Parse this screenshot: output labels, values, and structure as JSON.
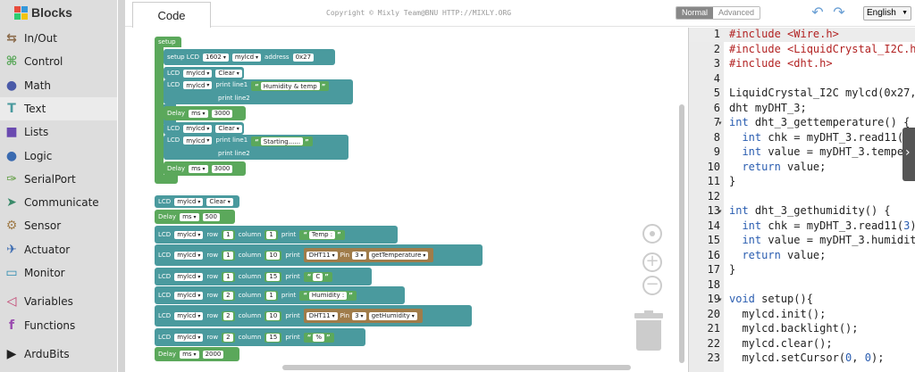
{
  "toolbox": {
    "title": "Blocks",
    "categories": [
      {
        "label": "In/Out",
        "icon": "arrows-icon",
        "color": "#8a6a4a",
        "glyph": "⇆"
      },
      {
        "label": "Control",
        "icon": "gamepad-icon",
        "color": "#5ba85b",
        "glyph": "⌘"
      },
      {
        "label": "Math",
        "icon": "math-icon",
        "color": "#4a5aa8",
        "glyph": "●"
      },
      {
        "label": "Text",
        "icon": "text-icon",
        "color": "#4a9a9e",
        "glyph": "T"
      },
      {
        "label": "Lists",
        "icon": "lists-icon",
        "color": "#6a4ab0",
        "glyph": "■"
      },
      {
        "label": "Logic",
        "icon": "bulb-icon",
        "color": "#3a6ab0",
        "glyph": "●"
      },
      {
        "label": "SerialPort",
        "icon": "plug-icon",
        "color": "#5a9a3a",
        "glyph": "✑"
      },
      {
        "label": "Communicate",
        "icon": "antenna-icon",
        "color": "#3a8a6a",
        "glyph": "➤"
      },
      {
        "label": "Sensor",
        "icon": "sensor-icon",
        "color": "#a07c4a",
        "glyph": "⚙"
      },
      {
        "label": "Actuator",
        "icon": "actuator-icon",
        "color": "#3a6ab0",
        "glyph": "✈"
      },
      {
        "label": "Monitor",
        "icon": "monitor-icon",
        "color": "#2a8ab0",
        "glyph": "▭"
      },
      {
        "label": "Variables",
        "icon": "variables-icon",
        "color": "#c03a6a",
        "glyph": "◁"
      },
      {
        "label": "Functions",
        "icon": "functions-icon",
        "color": "#9a4ab0",
        "glyph": "f"
      },
      {
        "label": "ArduBits",
        "icon": "play-icon",
        "color": "#222222",
        "glyph": "▶"
      }
    ],
    "selected": "Text"
  },
  "topbar": {
    "code_tab": "Code",
    "copyright": "Copyright © Mixly Team@BNU HTTP://MIXLY.ORG",
    "mode_normal": "Normal",
    "mode_advanced": "Advanced",
    "language": "English"
  },
  "workspace": {
    "setup": "setup",
    "setup_lcd": "setup LCD",
    "lcd_type": "1602",
    "lcd_name": "mylcd",
    "address_label": "address",
    "address": "0x27",
    "lcd": "LCD",
    "clear": "Clear",
    "print_line1": "print line1",
    "print_line2": "print line2",
    "delay": "Delay",
    "ms": "ms",
    "delay_3000": "3000",
    "delay_500": "500",
    "delay_2000": "2000",
    "text_humidity_temp": "Humidity & temp",
    "text_starting": "Starting......",
    "row": "row",
    "column": "column",
    "print": "print",
    "one": "1",
    "two": "2",
    "ten": "10",
    "fifteen": "15",
    "text_temp": "Temp :",
    "text_c": "C",
    "text_humidity": "Humidity :",
    "text_pct": "%",
    "dht": "DHT11",
    "pin": "Pin",
    "pin_value": "3",
    "get_temperature": "getTemperature",
    "get_humidity": "getHumidity"
  },
  "code": {
    "lines": [
      {
        "n": "1",
        "segs": [
          [
            "pp",
            "#include <Wire.h>"
          ]
        ]
      },
      {
        "n": "2",
        "segs": [
          [
            "pp",
            "#include <LiquidCrystal_I2C.h>"
          ]
        ]
      },
      {
        "n": "3",
        "segs": [
          [
            "pp",
            "#include <dht.h>"
          ]
        ]
      },
      {
        "n": "4",
        "segs": []
      },
      {
        "n": "5",
        "segs": [
          [
            "",
            "LiquidCrystal_I2C mylcd(0x27,16,2);"
          ]
        ]
      },
      {
        "n": "6",
        "segs": [
          [
            "",
            "dht myDHT_3;"
          ]
        ]
      },
      {
        "n": "7",
        "fold": true,
        "segs": [
          [
            "kw",
            "int"
          ],
          [
            "",
            " dht_3_gettemperature() {"
          ]
        ]
      },
      {
        "n": "8",
        "segs": [
          [
            "",
            "  "
          ],
          [
            "kw",
            "int"
          ],
          [
            "",
            " chk = myDHT_3.read11("
          ],
          [
            "num",
            "3"
          ],
          [
            "",
            ");"
          ]
        ]
      },
      {
        "n": "9",
        "segs": [
          [
            "",
            "  "
          ],
          [
            "kw",
            "int"
          ],
          [
            "",
            " value = myDHT_3.temperature;"
          ]
        ]
      },
      {
        "n": "10",
        "segs": [
          [
            "",
            "  "
          ],
          [
            "kw",
            "return"
          ],
          [
            "",
            " value;"
          ]
        ]
      },
      {
        "n": "11",
        "segs": [
          [
            "",
            "}"
          ]
        ]
      },
      {
        "n": "12",
        "segs": []
      },
      {
        "n": "13",
        "fold": true,
        "segs": [
          [
            "kw",
            "int"
          ],
          [
            "",
            " dht_3_gethumidity() {"
          ]
        ]
      },
      {
        "n": "14",
        "segs": [
          [
            "",
            "  "
          ],
          [
            "kw",
            "int"
          ],
          [
            "",
            " chk = myDHT_3.read11("
          ],
          [
            "num",
            "3"
          ],
          [
            "",
            ");"
          ]
        ]
      },
      {
        "n": "15",
        "segs": [
          [
            "",
            "  "
          ],
          [
            "kw",
            "int"
          ],
          [
            "",
            " value = myDHT_3.humidity;"
          ]
        ]
      },
      {
        "n": "16",
        "segs": [
          [
            "",
            "  "
          ],
          [
            "kw",
            "return"
          ],
          [
            "",
            " value;"
          ]
        ]
      },
      {
        "n": "17",
        "segs": [
          [
            "",
            "}"
          ]
        ]
      },
      {
        "n": "18",
        "segs": []
      },
      {
        "n": "19",
        "fold": true,
        "segs": [
          [
            "kw",
            "void"
          ],
          [
            "",
            " setup(){"
          ]
        ]
      },
      {
        "n": "20",
        "segs": [
          [
            "",
            "  mylcd.init();"
          ]
        ]
      },
      {
        "n": "21",
        "segs": [
          [
            "",
            "  mylcd.backlight();"
          ]
        ]
      },
      {
        "n": "22",
        "segs": [
          [
            "",
            "  mylcd.clear();"
          ]
        ]
      },
      {
        "n": "23",
        "segs": [
          [
            "",
            "  mylcd.setCursor("
          ],
          [
            "num",
            "0"
          ],
          [
            "",
            ", "
          ],
          [
            "num",
            "0"
          ],
          [
            "",
            ");"
          ]
        ]
      }
    ]
  },
  "colors": {
    "block_teal": "#4a9a9e",
    "block_green": "#5ba85b",
    "block_brown": "#a07c4a",
    "keyword": "#2a5db0",
    "preprocessor": "#b22222"
  }
}
